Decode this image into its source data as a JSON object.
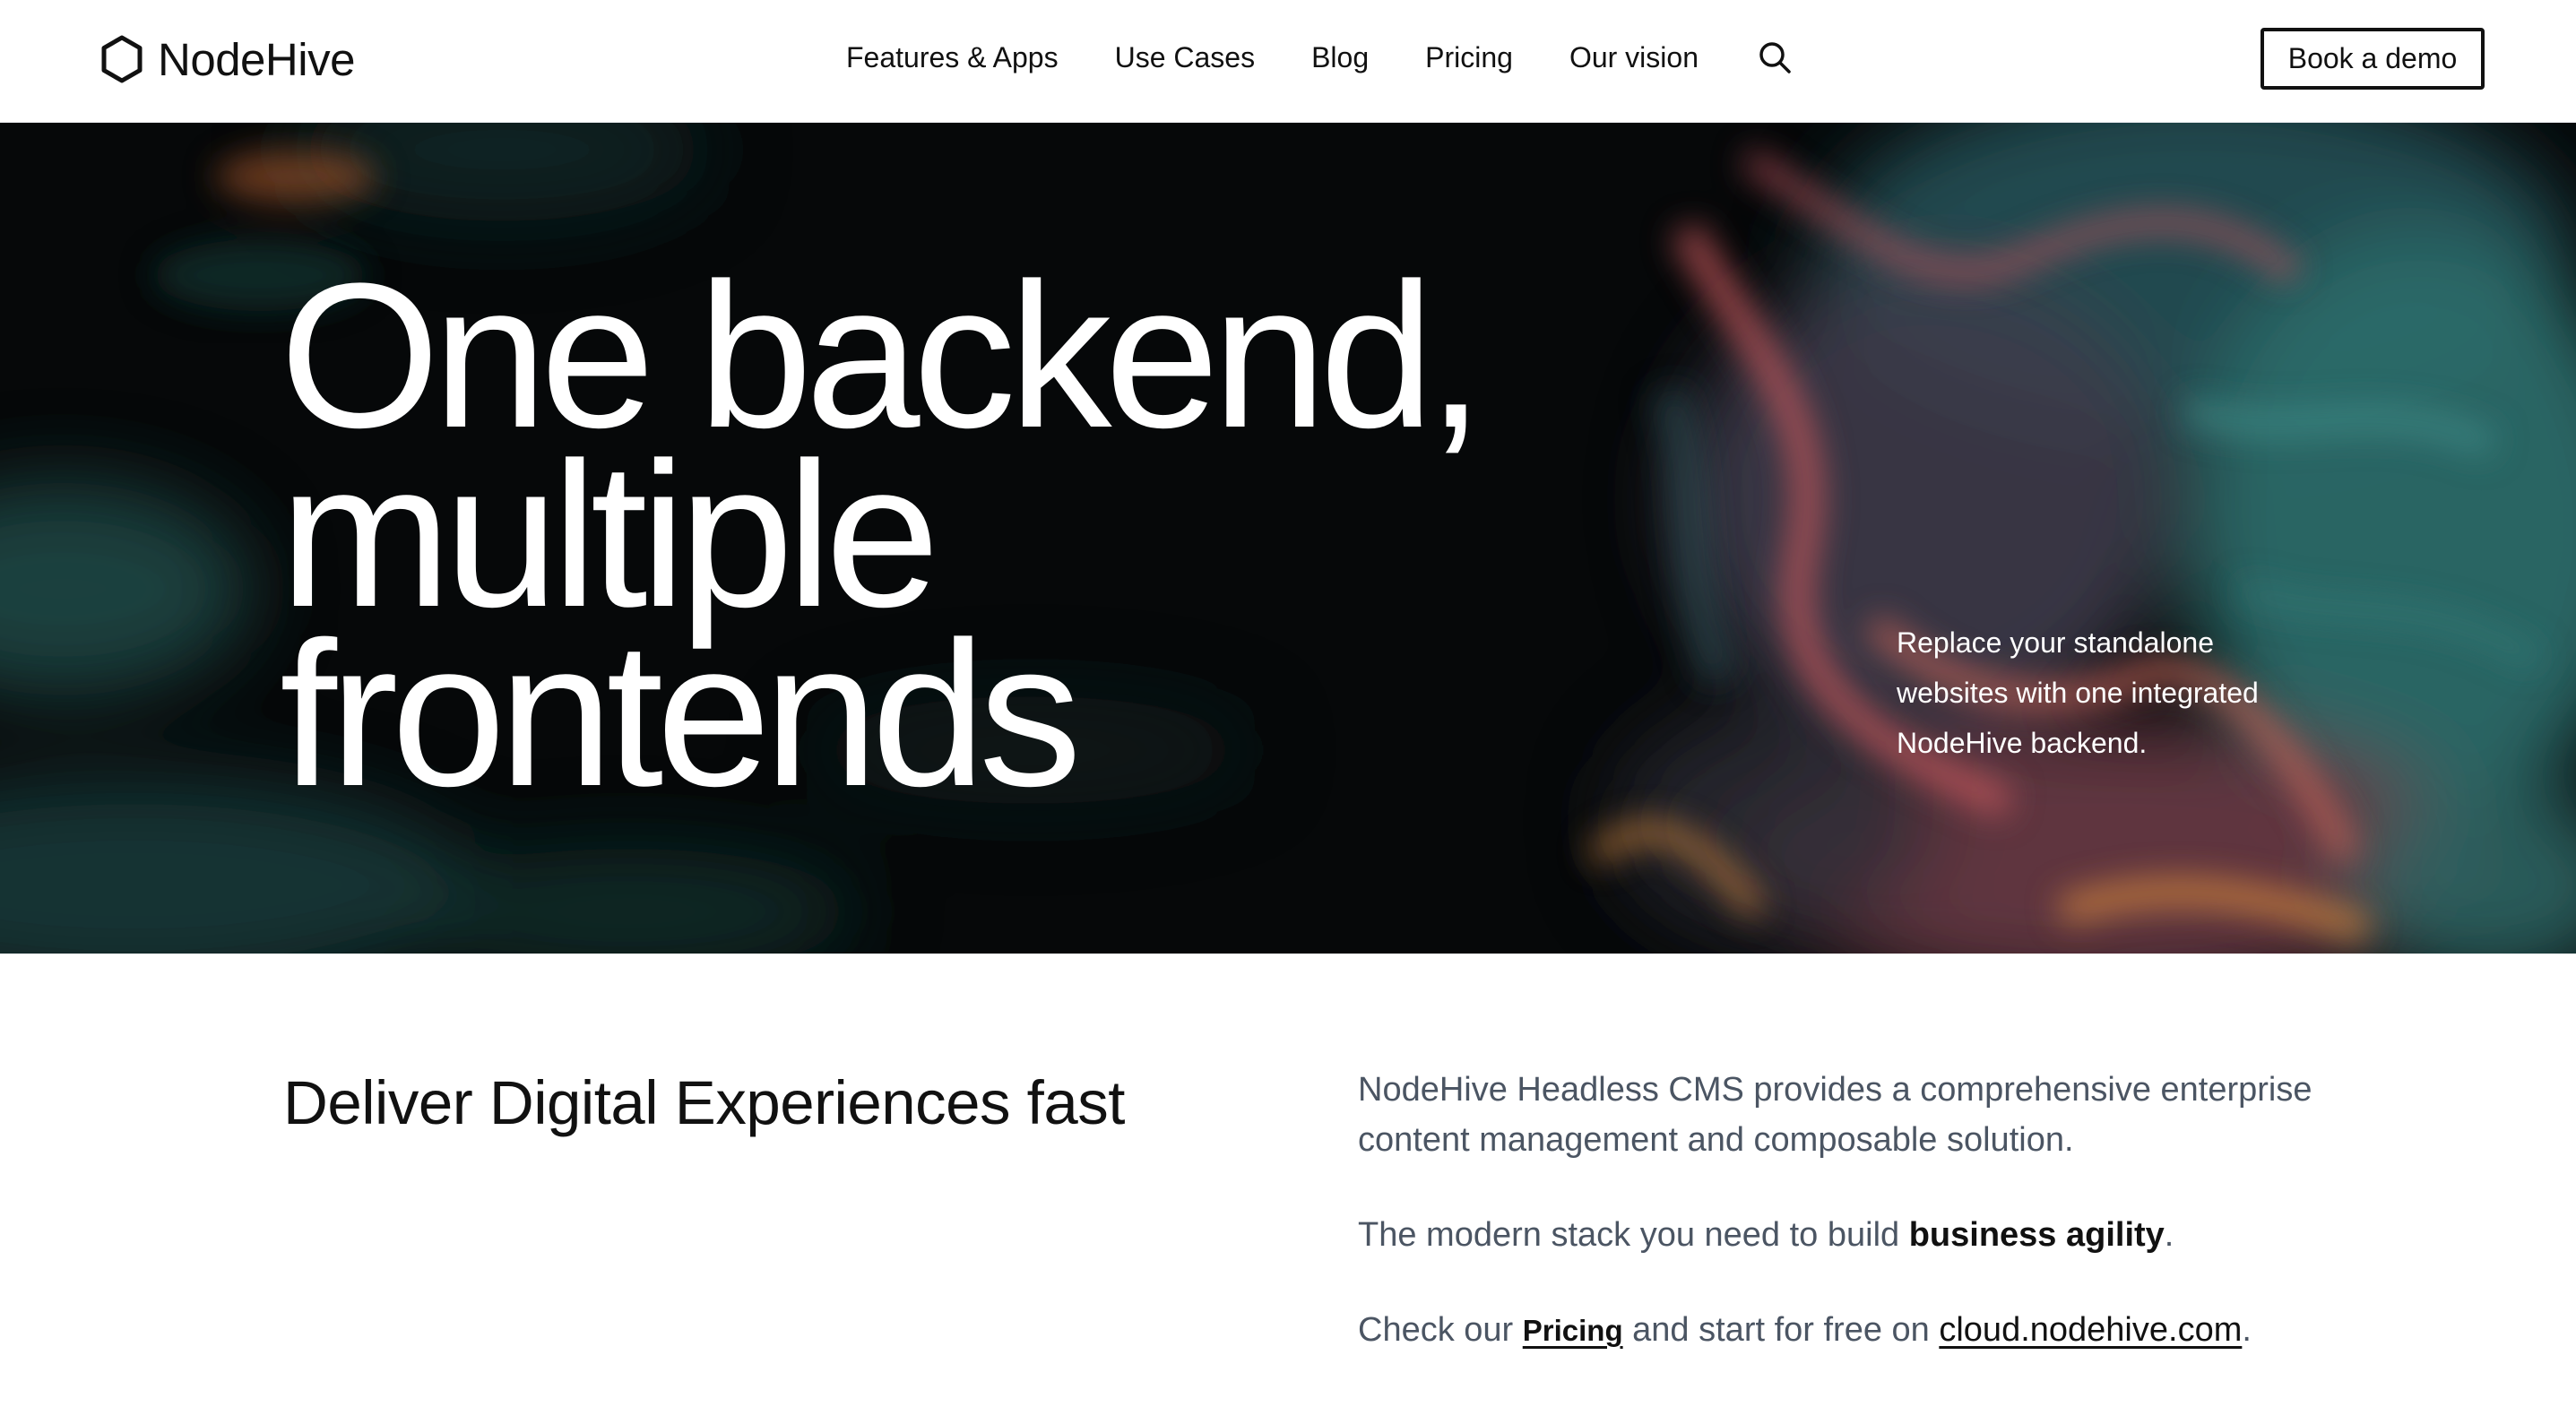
{
  "header": {
    "logo_text": "NodeHive",
    "nav": [
      "Features & Apps",
      "Use Cases",
      "Blog",
      "Pricing",
      "Our vision"
    ],
    "cta": "Book a demo"
  },
  "hero": {
    "title_lines": [
      "One backend,",
      "multiple",
      "frontends"
    ],
    "subtitle": "Replace your standalone websites with one integrated NodeHive backend."
  },
  "intro": {
    "heading": "Deliver Digital Experiences fast",
    "paragraph1": "NodeHive Headless CMS provides a comprehensive enterprise content management and composable solution.",
    "paragraph2_prefix": "The modern stack you need to build ",
    "paragraph2_bold": "business agility",
    "paragraph2_suffix": ".",
    "paragraph3_prefix": "Check our ",
    "paragraph3_link1": "Pricing",
    "paragraph3_middle": " and start for free on ",
    "paragraph3_link2": "cloud.nodehive.com",
    "paragraph3_suffix": "."
  },
  "icons": {
    "logo": "hexagon-logo-icon",
    "search": "search-icon"
  },
  "colors": {
    "hero_dark": "#060809",
    "teal": "#2a6b6a",
    "salmon": "#c0555a",
    "orange": "#d88a3e",
    "text_dark": "#111111",
    "text_gray": "#4b5563"
  }
}
